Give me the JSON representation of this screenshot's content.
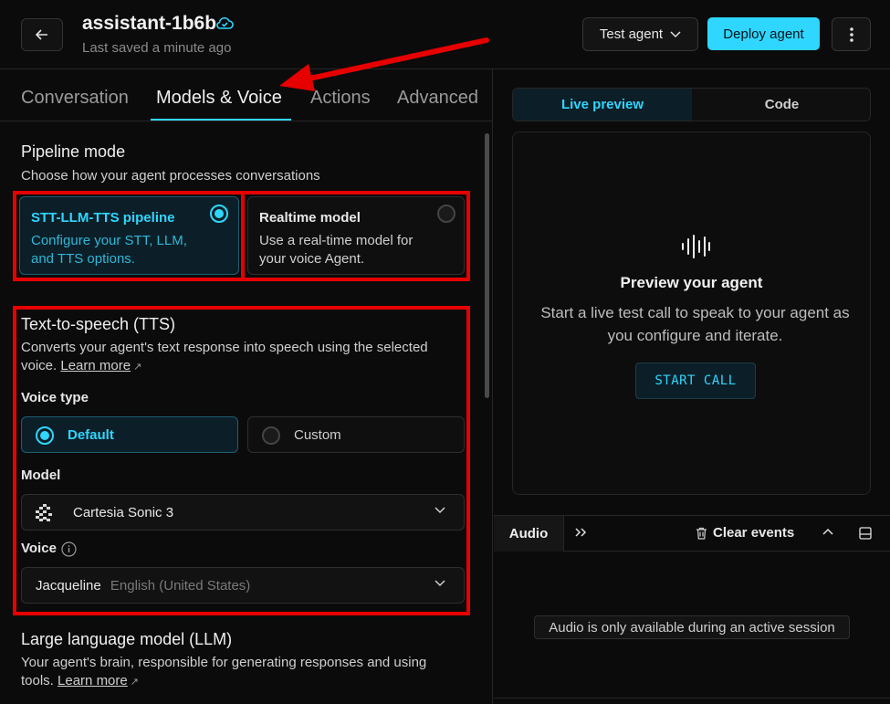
{
  "header": {
    "title": "assistant-1b6b",
    "saved": "Last saved a minute ago",
    "test_agent": "Test agent",
    "deploy": "Deploy agent"
  },
  "tabs": [
    "Conversation",
    "Models & Voice",
    "Actions",
    "Advanced"
  ],
  "pipeline": {
    "heading": "Pipeline mode",
    "desc": "Choose how your agent processes conversations",
    "options": [
      {
        "title": "STT-LLM-TTS pipeline",
        "desc_line1": "Configure your STT, LLM,",
        "desc_line2": "and TTS options.",
        "selected": true
      },
      {
        "title": "Realtime model",
        "desc_line1": "Use a real-time model for",
        "desc_line2": "your voice Agent.",
        "selected": false
      }
    ]
  },
  "tts": {
    "heading": "Text-to-speech (TTS)",
    "desc_line1": "Converts your agent's text response into speech using the selected",
    "desc_line2": "voice.",
    "learn_more": "Learn more",
    "voice_type_label": "Voice type",
    "voice_types": [
      {
        "label": "Default",
        "selected": true
      },
      {
        "label": "Custom",
        "selected": false
      }
    ],
    "model_label": "Model",
    "model_value": "Cartesia Sonic 3",
    "voice_label": "Voice",
    "voice_name": "Jacqueline",
    "voice_locale": "English (United States)"
  },
  "llm": {
    "heading": "Large language model (LLM)",
    "desc_line1": "Your agent's brain, responsible for generating responses and using",
    "desc_line2": "tools.",
    "learn_more": "Learn more"
  },
  "preview": {
    "tabs": [
      "Live preview",
      "Code"
    ],
    "title": "Preview your agent",
    "desc": "Start a live test call to speak to your agent as you configure and iterate.",
    "start_call": "START CALL"
  },
  "events": {
    "audio_tab": "Audio",
    "clear": "Clear events",
    "note": "Audio is only available during an active session"
  },
  "colors": {
    "accent": "#2fd6ff",
    "annotation": "#e60000",
    "background": "#0b0b0b"
  }
}
